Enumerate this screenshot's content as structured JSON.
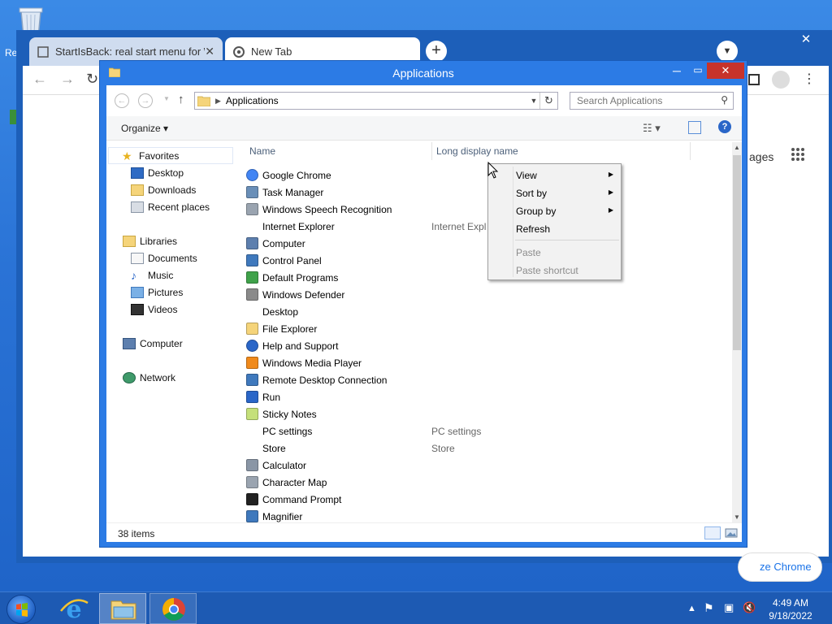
{
  "desktop": {
    "recycle_label": "Re"
  },
  "chrome": {
    "tabs": [
      {
        "title": "StartIsBack: real start menu for W"
      },
      {
        "title": "New Tab"
      }
    ],
    "newtab_label": "+",
    "close_label": "✕",
    "images_label": "ages",
    "customize_label": "ze Chrome"
  },
  "explorer": {
    "title": "Applications",
    "address": "Applications",
    "search_placeholder": "Search Applications",
    "organize_label": "Organize ▾",
    "columns": {
      "name": "Name",
      "long": "Long display name"
    },
    "nav": {
      "favorites": "Favorites",
      "desktop": "Desktop",
      "downloads": "Downloads",
      "recent": "Recent places",
      "libraries": "Libraries",
      "documents": "Documents",
      "music": "Music",
      "pictures": "Pictures",
      "videos": "Videos",
      "computer": "Computer",
      "network": "Network"
    },
    "items": [
      {
        "name": "Google Chrome",
        "long": ""
      },
      {
        "name": "Task Manager",
        "long": ""
      },
      {
        "name": "Windows Speech Recognition",
        "long": ""
      },
      {
        "name": "Internet Explorer",
        "long": "Internet Expl"
      },
      {
        "name": "Computer",
        "long": ""
      },
      {
        "name": "Control Panel",
        "long": ""
      },
      {
        "name": "Default Programs",
        "long": ""
      },
      {
        "name": "Windows Defender",
        "long": ""
      },
      {
        "name": "Desktop",
        "long": ""
      },
      {
        "name": "File Explorer",
        "long": ""
      },
      {
        "name": "Help and Support",
        "long": ""
      },
      {
        "name": "Windows Media Player",
        "long": ""
      },
      {
        "name": "Remote Desktop Connection",
        "long": ""
      },
      {
        "name": "Run",
        "long": ""
      },
      {
        "name": "Sticky Notes",
        "long": ""
      },
      {
        "name": "PC settings",
        "long": "PC settings"
      },
      {
        "name": "Store",
        "long": "Store"
      },
      {
        "name": "Calculator",
        "long": ""
      },
      {
        "name": "Character Map",
        "long": ""
      },
      {
        "name": "Command Prompt",
        "long": ""
      },
      {
        "name": "Magnifier",
        "long": ""
      }
    ],
    "status": "38 items"
  },
  "context_menu": {
    "view": "View",
    "sort_by": "Sort by",
    "group_by": "Group by",
    "refresh": "Refresh",
    "paste": "Paste",
    "paste_shortcut": "Paste shortcut"
  },
  "taskbar": {
    "time": "4:49 AM",
    "date": "9/18/2022"
  }
}
